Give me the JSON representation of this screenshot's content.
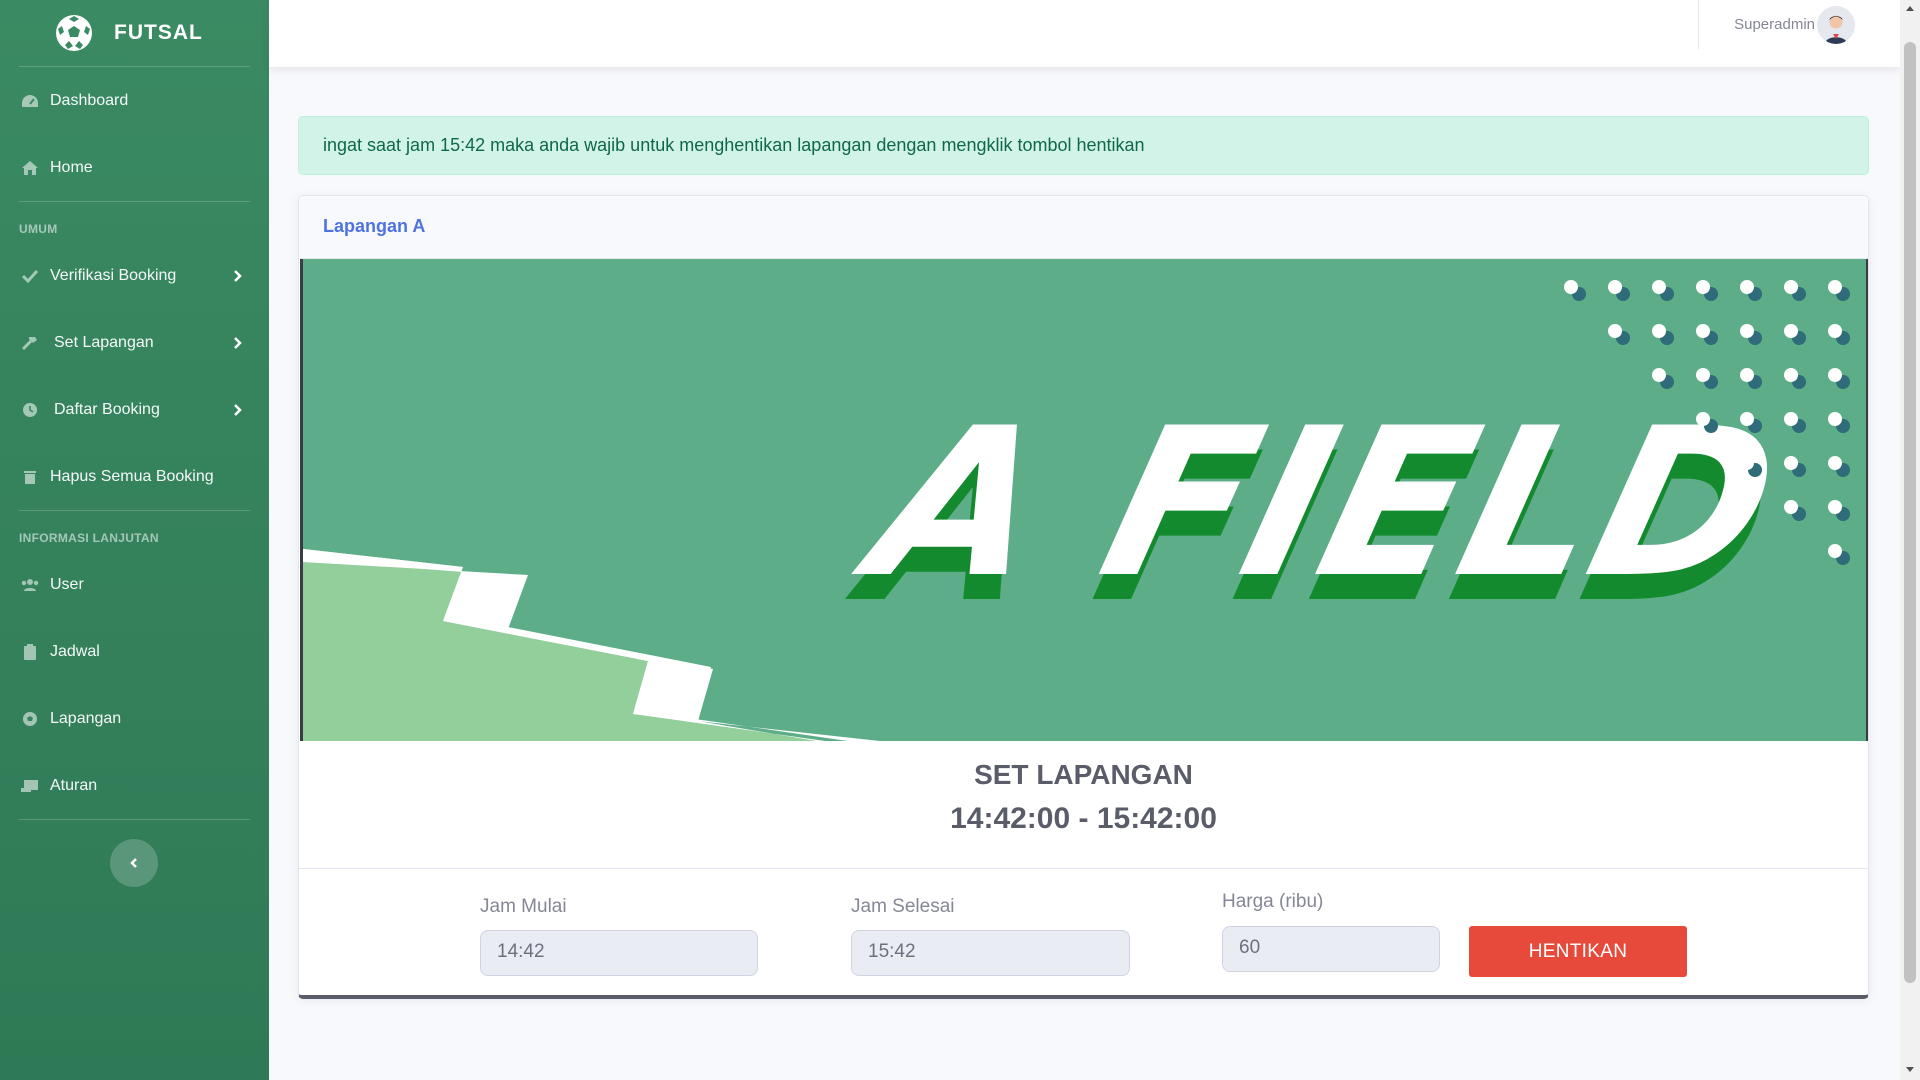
{
  "brand": {
    "name": "FUTSAL"
  },
  "sidebar": {
    "items": [
      {
        "label": "Dashboard"
      },
      {
        "label": "Home"
      }
    ],
    "section_umum": "UMUM",
    "umum_items": [
      {
        "label": "Verifikasi Booking"
      },
      {
        "label": "Set Lapangan"
      },
      {
        "label": "Daftar Booking"
      },
      {
        "label": "Hapus Semua Booking"
      }
    ],
    "section_info": "INFORMASI LANJUTAN",
    "info_items": [
      {
        "label": "User"
      },
      {
        "label": "Jadwal"
      },
      {
        "label": "Lapangan"
      },
      {
        "label": "Aturan"
      }
    ]
  },
  "topbar": {
    "user_name": "Superadmin"
  },
  "alert": {
    "text": "ingat saat jam 15:42 maka anda wajib untuk menghentikan lapangan dengan mengklik tombol hentikan"
  },
  "card": {
    "title": "Lapangan A",
    "image_text": "A FIELD",
    "set_title": "SET LAPANGAN",
    "set_time": "14:42:00 - 15:42:00",
    "form": {
      "start_label": "Jam Mulai",
      "start_value": "14:42",
      "end_label": "Jam Selesai",
      "end_value": "15:42",
      "price_label": "Harga (ribu)",
      "price_value": "60",
      "stop_button": "HENTIKAN"
    }
  },
  "colors": {
    "sidebar": "#3a8a63",
    "field_green": "#5cad88",
    "light_green": "#93cf9b",
    "dark_letter_shadow": "#138a2e",
    "danger": "#e74a3b",
    "primary": "#4e73df",
    "dot_dark": "#2f6b78"
  }
}
